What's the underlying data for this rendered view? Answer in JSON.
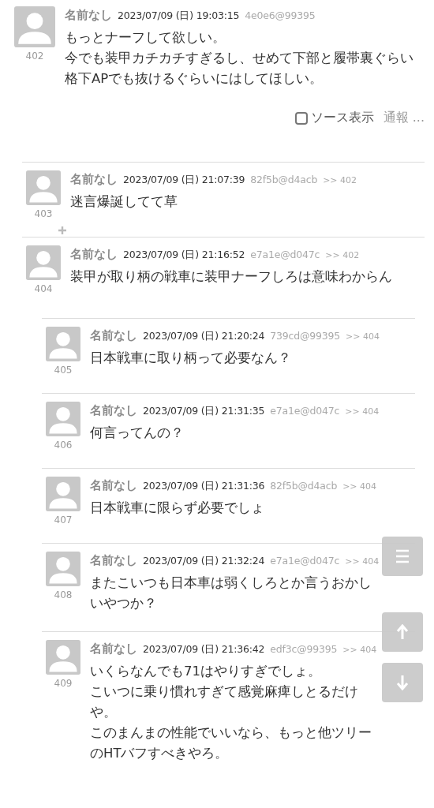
{
  "posts": [
    {
      "number": "402",
      "name": "名前なし",
      "date": "2023/07/09 (日) 19:03:15",
      "id": "4e0e6@99395",
      "body": [
        "もっとナーフして欲しい。",
        "今でも装甲カチカチすぎるし、せめて下部と履帯裏ぐらい格下APでも抜けるぐらいにはしてほしい。"
      ],
      "footer": {
        "source_toggle": {
          "label": "ソース表示",
          "checked": false
        },
        "report": "通報 ..."
      },
      "children": [
        {
          "number": "403",
          "name": "名前なし",
          "date": "2023/07/09 (日) 21:07:39",
          "id": "82f5b@d4acb",
          "reply_to": ">> 402",
          "body": "迷言爆誕してて草",
          "expandable": true
        },
        {
          "number": "404",
          "name": "名前なし",
          "date": "2023/07/09 (日) 21:16:52",
          "id": "e7a1e@d047c",
          "reply_to": ">> 402",
          "body": "装甲が取り柄の戦車に装甲ナーフしろは意味わからん",
          "children": [
            {
              "number": "405",
              "name": "名前なし",
              "date": "2023/07/09 (日) 21:20:24",
              "id": "739cd@99395",
              "reply_to": ">> 404",
              "body": "日本戦車に取り柄って必要なん？"
            },
            {
              "number": "406",
              "name": "名前なし",
              "date": "2023/07/09 (日) 21:31:35",
              "id": "e7a1e@d047c",
              "reply_to": ">> 404",
              "body": "何言ってんの？"
            },
            {
              "number": "407",
              "name": "名前なし",
              "date": "2023/07/09 (日) 21:31:36",
              "id": "82f5b@d4acb",
              "reply_to": ">> 404",
              "body": "日本戦車に限らず必要でしょ"
            },
            {
              "number": "408",
              "name": "名前なし",
              "date": "2023/07/09 (日) 21:32:24",
              "id": "e7a1e@d047c",
              "reply_to": ">> 404",
              "body": "またこいつも日本車は弱くしろとか言うおかしいやつか？"
            },
            {
              "number": "409",
              "name": "名前なし",
              "date": "2023/07/09 (日) 21:36:42",
              "id": "edf3c@99395",
              "reply_to": ">> 404",
              "body": [
                "いくらなんでも71はやりすぎでしょ。",
                "こいつに乗り慣れすぎて感覚麻痺しとるだけや。",
                "このまんまの性能でいいなら、もっと他ツリーのHTバフすべきやろ。"
              ]
            }
          ]
        }
      ]
    }
  ]
}
